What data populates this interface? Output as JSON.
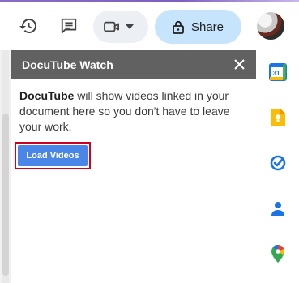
{
  "toolbar": {
    "history_icon": "history-icon",
    "comment_icon": "comment-icon",
    "meet_icon": "video-camera-icon",
    "share_label": "Share",
    "share_icon": "lock-icon"
  },
  "panel": {
    "title": "DocuTube Watch",
    "close_icon": "close-icon",
    "desc_bold": "DocuTube",
    "desc_rest": " will show videos linked in your document here so you don't have to leave your work.",
    "load_button_label": "Load Videos"
  },
  "rail": {
    "calendar_label": "31",
    "icons": [
      "calendar-icon",
      "keep-icon",
      "tasks-icon",
      "contacts-icon",
      "maps-icon"
    ]
  },
  "colors": {
    "accent": "#4a86e8",
    "highlight": "#d0021b",
    "share_bg": "#c6e4fb",
    "panel_header": "#616161"
  }
}
